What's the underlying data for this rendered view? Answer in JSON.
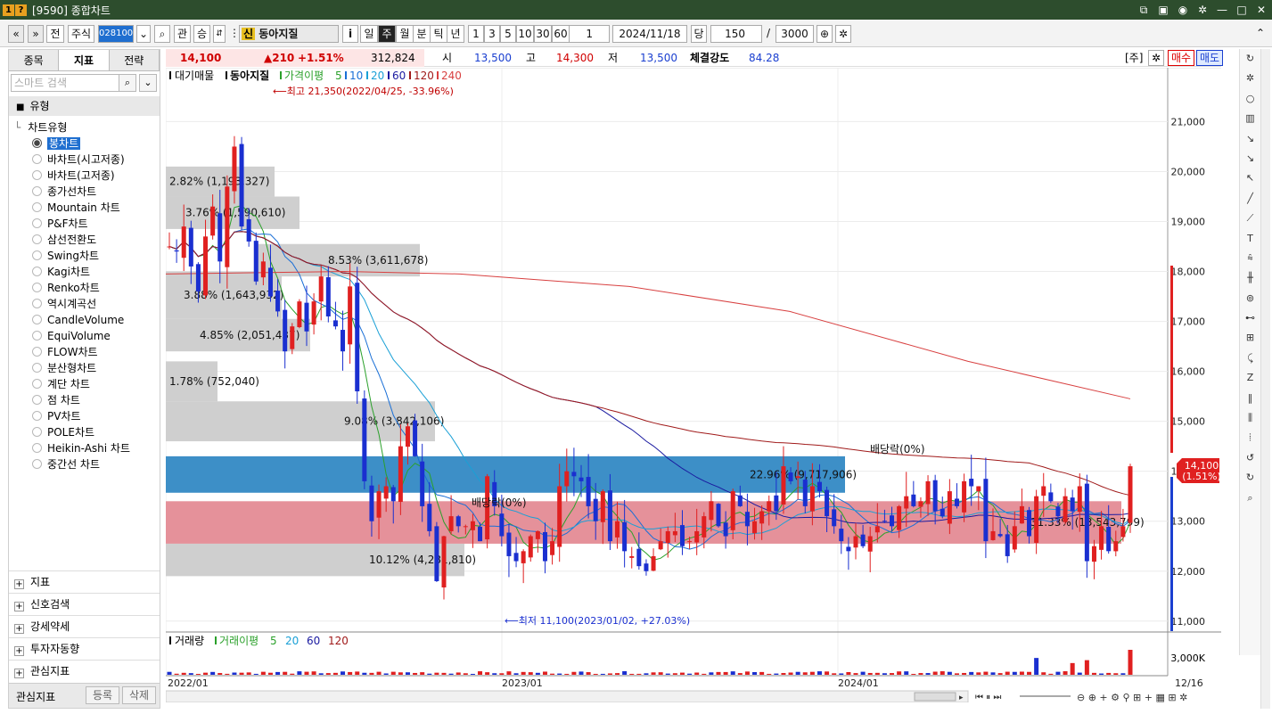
{
  "window": {
    "title": "[9590] 종합차트",
    "badge1": "1",
    "badge2": "?"
  },
  "toolbar": {
    "nav_prev": "«",
    "nav_down": "»",
    "prev": "전",
    "type": "주식",
    "code": "028100",
    "search": "⌕",
    "view": "관",
    "inc": "승",
    "name": "동아지질",
    "name_prefix": "신",
    "info": "i",
    "periods": [
      "일",
      "주",
      "월",
      "분",
      "틱",
      "년"
    ],
    "active_period": "주",
    "intervals": [
      "1",
      "3",
      "5",
      "10",
      "30",
      "60"
    ],
    "spin": "1",
    "date": "2024/11/18",
    "unit": "당",
    "count": "150",
    "slash": "/",
    "total": "3000"
  },
  "left": {
    "tabs": [
      "종목",
      "지표",
      "전략"
    ],
    "active_tab": "지표",
    "search_placeholder": "스마트 검색",
    "group": "유형",
    "tree_root": "차트유형",
    "chart_types": [
      "봉차트",
      "바차트(시고저종)",
      "바차트(고저종)",
      "종가선차트",
      "Mountain 차트",
      "P&F차트",
      "삼선전환도",
      "Swing차트",
      "Kagi차트",
      "Renko차트",
      "역시계곡선",
      "CandleVolume",
      "EquiVolume",
      "FLOW차트",
      "분산형차트",
      "계단 차트",
      "점 차트",
      "PV차트",
      "POLE차트",
      "Heikin-Ashi 차트",
      "중간선 차트"
    ],
    "selected": "봉차트",
    "bottom": [
      "지표",
      "신호검색",
      "강세약세",
      "투자자동향",
      "관심지표"
    ],
    "interest": {
      "label": "관심지표",
      "register": "등록",
      "delete": "삭제"
    }
  },
  "quote": {
    "price": "14,100",
    "change": "▲210",
    "rate": "+1.51%",
    "volume": "312,824",
    "open_label": "시",
    "open": "13,500",
    "high_label": "고",
    "high": "14,300",
    "low_label": "저",
    "low": "13,500",
    "strength_label": "체결강도",
    "strength": "84.28",
    "market": "[주]",
    "buy": "매수",
    "sell": "매도"
  },
  "legend": {
    "stock": "대기매물",
    "name": "동아지질",
    "ma_label": "가격이평",
    "periods": [
      "5",
      "10",
      "20",
      "60",
      "120",
      "240"
    ],
    "colors": [
      "#2aa02a",
      "#1a6fd6",
      "#1aa0d6",
      "#1a1aa0",
      "#a01a1a",
      "#d84040"
    ]
  },
  "annotations": {
    "high": "최고 21,350(2022/04/25, -33.96%)",
    "low": "최저 11,100(2023/01/02, +27.03%)",
    "div1": "배당락(0%)",
    "div2": "배당락(0%)"
  },
  "chart_data": {
    "type": "candlestick",
    "y_ticks": [
      "21,000",
      "20,000",
      "19,000",
      "18,000",
      "17,000",
      "16,000",
      "15,000",
      "14,000",
      "13,000",
      "12,000",
      "11,000"
    ],
    "ylim": [
      10800,
      21900
    ],
    "x_ticks": [
      "2022/01",
      "2023/01",
      "2024/01",
      "12/16"
    ],
    "last_price": "14,100",
    "last_rate": "(1.51%)",
    "volume_profile": [
      {
        "label": "2.82% (1,193,327)",
        "value": 2.82
      },
      {
        "label": "3.76% (1,590,610)",
        "value": 3.76
      },
      {
        "label": "8.53% (3,611,678)",
        "value": 8.53
      },
      {
        "label": "3.88% (1,643,932)",
        "value": 3.88
      },
      {
        "label": "4.85% (2,051,437)",
        "value": 4.85
      },
      {
        "label": "1.78% (752,040)",
        "value": 1.78
      },
      {
        "label": "9.08% (3,842,106)",
        "value": 9.08
      },
      {
        "label": "22.96% (9,717,906)",
        "value": 22.96
      },
      {
        "label": "31.33% (13,543,799)",
        "value": 31.33
      },
      {
        "label": "10.12% (4,281,810)",
        "value": 10.12
      }
    ]
  },
  "volume": {
    "title": "거래량",
    "ma_label": "거래이평",
    "periods": [
      "5",
      "20",
      "60",
      "120"
    ],
    "tick": "3,000K"
  }
}
